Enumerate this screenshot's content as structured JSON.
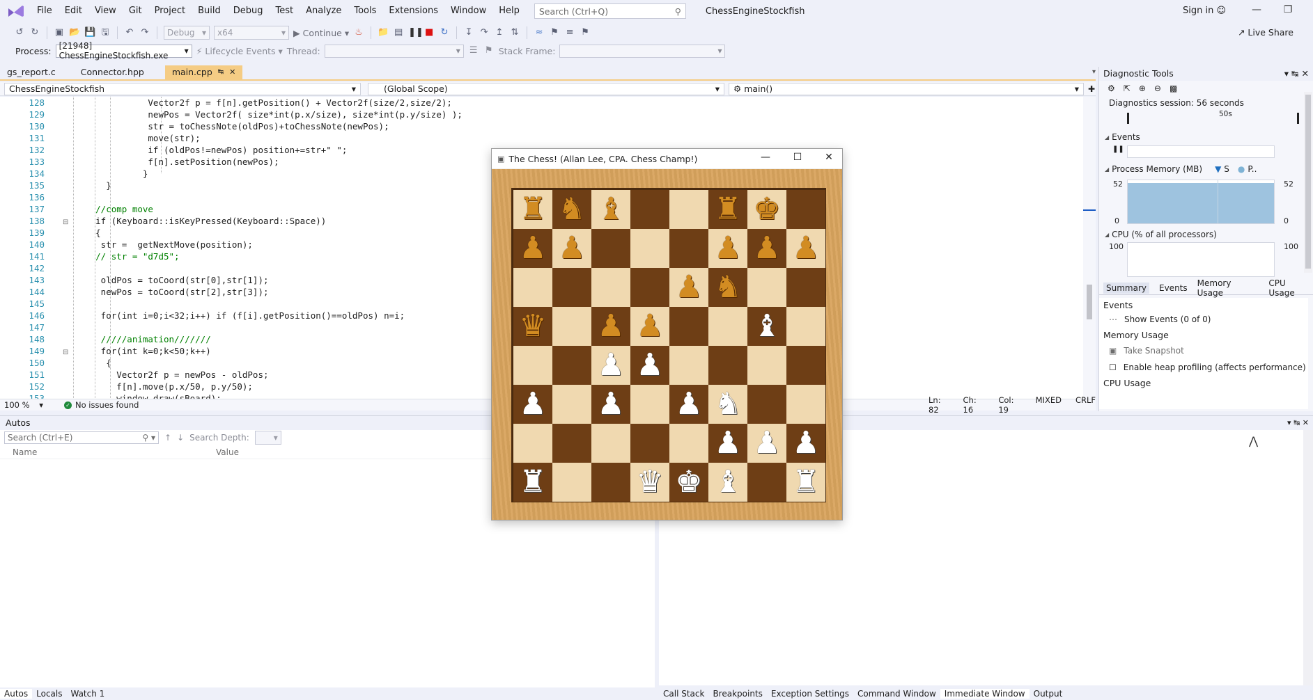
{
  "menubar": {
    "items": [
      "File",
      "Edit",
      "View",
      "Git",
      "Project",
      "Build",
      "Debug",
      "Test",
      "Analyze",
      "Tools",
      "Extensions",
      "Window",
      "Help"
    ],
    "search_placeholder": "Search (Ctrl+Q)",
    "solution_name": "ChessEngineStockfish",
    "signin": "Sign in",
    "liveshare": "Live Share"
  },
  "toolbar": {
    "config": "Debug",
    "platform": "x64",
    "continue": "Continue"
  },
  "debugbar": {
    "process_label": "Process:",
    "process_value": "[21948] ChessEngineStockfish.exe",
    "lifecycle": "Lifecycle Events",
    "thread_label": "Thread:",
    "stackframe_label": "Stack Frame:"
  },
  "doc_tabs": [
    {
      "label": "gs_report.c"
    },
    {
      "label": "Connector.hpp"
    },
    {
      "label": "main.cpp"
    }
  ],
  "nav": {
    "project": "ChessEngineStockfish",
    "scope": "(Global Scope)",
    "member": "main()"
  },
  "code_lines": [
    {
      "n": "128",
      "t": "                Vector2f p = f[n].getPosition() + Vector2f(size/2,size/2);"
    },
    {
      "n": "129",
      "t": "                newPos = Vector2f( size*int(p.x/size), size*int(p.y/size) );"
    },
    {
      "n": "130",
      "t": "                str = toChessNote(oldPos)+toChessNote(newPos);"
    },
    {
      "n": "131",
      "t": "                move(str);"
    },
    {
      "n": "132",
      "t": "                if (oldPos!=newPos) position+=str+\" \";"
    },
    {
      "n": "133",
      "t": "                f[n].setPosition(newPos);"
    },
    {
      "n": "134",
      "t": "               }"
    },
    {
      "n": "135",
      "t": "        }"
    },
    {
      "n": "136",
      "t": ""
    },
    {
      "n": "137",
      "t": "      //comp move"
    },
    {
      "n": "138",
      "t": "      if (Keyboard::isKeyPressed(Keyboard::Space))"
    },
    {
      "n": "139",
      "t": "      {"
    },
    {
      "n": "140",
      "t": "       str =  getNextMove(position);"
    },
    {
      "n": "141",
      "t": "      // str = \"d7d5\";"
    },
    {
      "n": "142",
      "t": ""
    },
    {
      "n": "143",
      "t": "       oldPos = toCoord(str[0],str[1]);"
    },
    {
      "n": "144",
      "t": "       newPos = toCoord(str[2],str[3]);"
    },
    {
      "n": "145",
      "t": ""
    },
    {
      "n": "146",
      "t": "       for(int i=0;i<32;i++) if (f[i].getPosition()==oldPos) n=i;"
    },
    {
      "n": "147",
      "t": ""
    },
    {
      "n": "148",
      "t": "       /////animation///////"
    },
    {
      "n": "149",
      "t": "       for(int k=0;k<50;k++)"
    },
    {
      "n": "150",
      "t": "        {"
    },
    {
      "n": "151",
      "t": "          Vector2f p = newPos - oldPos;"
    },
    {
      "n": "152",
      "t": "          f[n].move(p.x/50, p.y/50);"
    },
    {
      "n": "153",
      "t": "          window.draw(sBoard);"
    }
  ],
  "status": {
    "zoom": "100 %",
    "issues": "No issues found",
    "ln": "Ln: 82",
    "ch": "Ch: 16",
    "col": "Col: 19",
    "mode": "MIXED",
    "eol": "CRLF"
  },
  "diag": {
    "title": "Diagnostic Tools",
    "session": "Diagnostics session: 56 seconds",
    "timeline_mark": "50s",
    "events_label": "Events",
    "memory_label": "Process Memory (MB)",
    "memory_legend_s": "S",
    "memory_legend_p": "P..",
    "mem_max_left": "52",
    "mem_min_left": "0",
    "mem_max_right": "52",
    "mem_min_right": "0",
    "cpu_label": "CPU (% of all processors)",
    "cpu_max_left": "100",
    "cpu_max_right": "100",
    "tabs": [
      "Summary",
      "Events",
      "Memory Usage",
      "CPU Usage"
    ],
    "summary_events": "Events",
    "show_events": "Show Events (0 of 0)",
    "memory_usage": "Memory Usage",
    "take_snapshot": "Take Snapshot",
    "heap_profiling": "Enable heap profiling (affects performance)",
    "cpu_usage": "CPU Usage"
  },
  "autos": {
    "title": "Autos",
    "search_placeholder": "Search (Ctrl+E)",
    "search_depth": "Search Depth:",
    "col_name": "Name",
    "col_value": "Value"
  },
  "bottom_tabs_left": [
    "Autos",
    "Locals",
    "Watch 1"
  ],
  "bottom_tabs_right": [
    "Call Stack",
    "Breakpoints",
    "Exception Settings",
    "Command Window",
    "Immediate Window",
    "Output"
  ],
  "chess": {
    "title": "The Chess! (Allan Lee, CPA. Chess Champ!)",
    "board": [
      [
        "bR",
        "bN",
        "bB",
        "",
        "",
        "bR",
        "bK",
        ""
      ],
      [
        "bP",
        "bP",
        "",
        "",
        "",
        "bP",
        "bP",
        "bP"
      ],
      [
        "",
        "",
        "",
        "",
        "bP",
        "bN",
        "",
        ""
      ],
      [
        "bQ",
        "",
        "bP",
        "bP",
        "",
        "",
        "wB",
        ""
      ],
      [
        "",
        "",
        "wP",
        "wP",
        "",
        "",
        "",
        ""
      ],
      [
        "wP",
        "",
        "wP",
        "",
        "wP",
        "wN",
        "",
        ""
      ],
      [
        "",
        "",
        "",
        "",
        "",
        "wP",
        "wP",
        "wP"
      ],
      [
        "wR",
        "",
        "",
        "wQ",
        "wK",
        "wB",
        "",
        "wR"
      ]
    ]
  }
}
